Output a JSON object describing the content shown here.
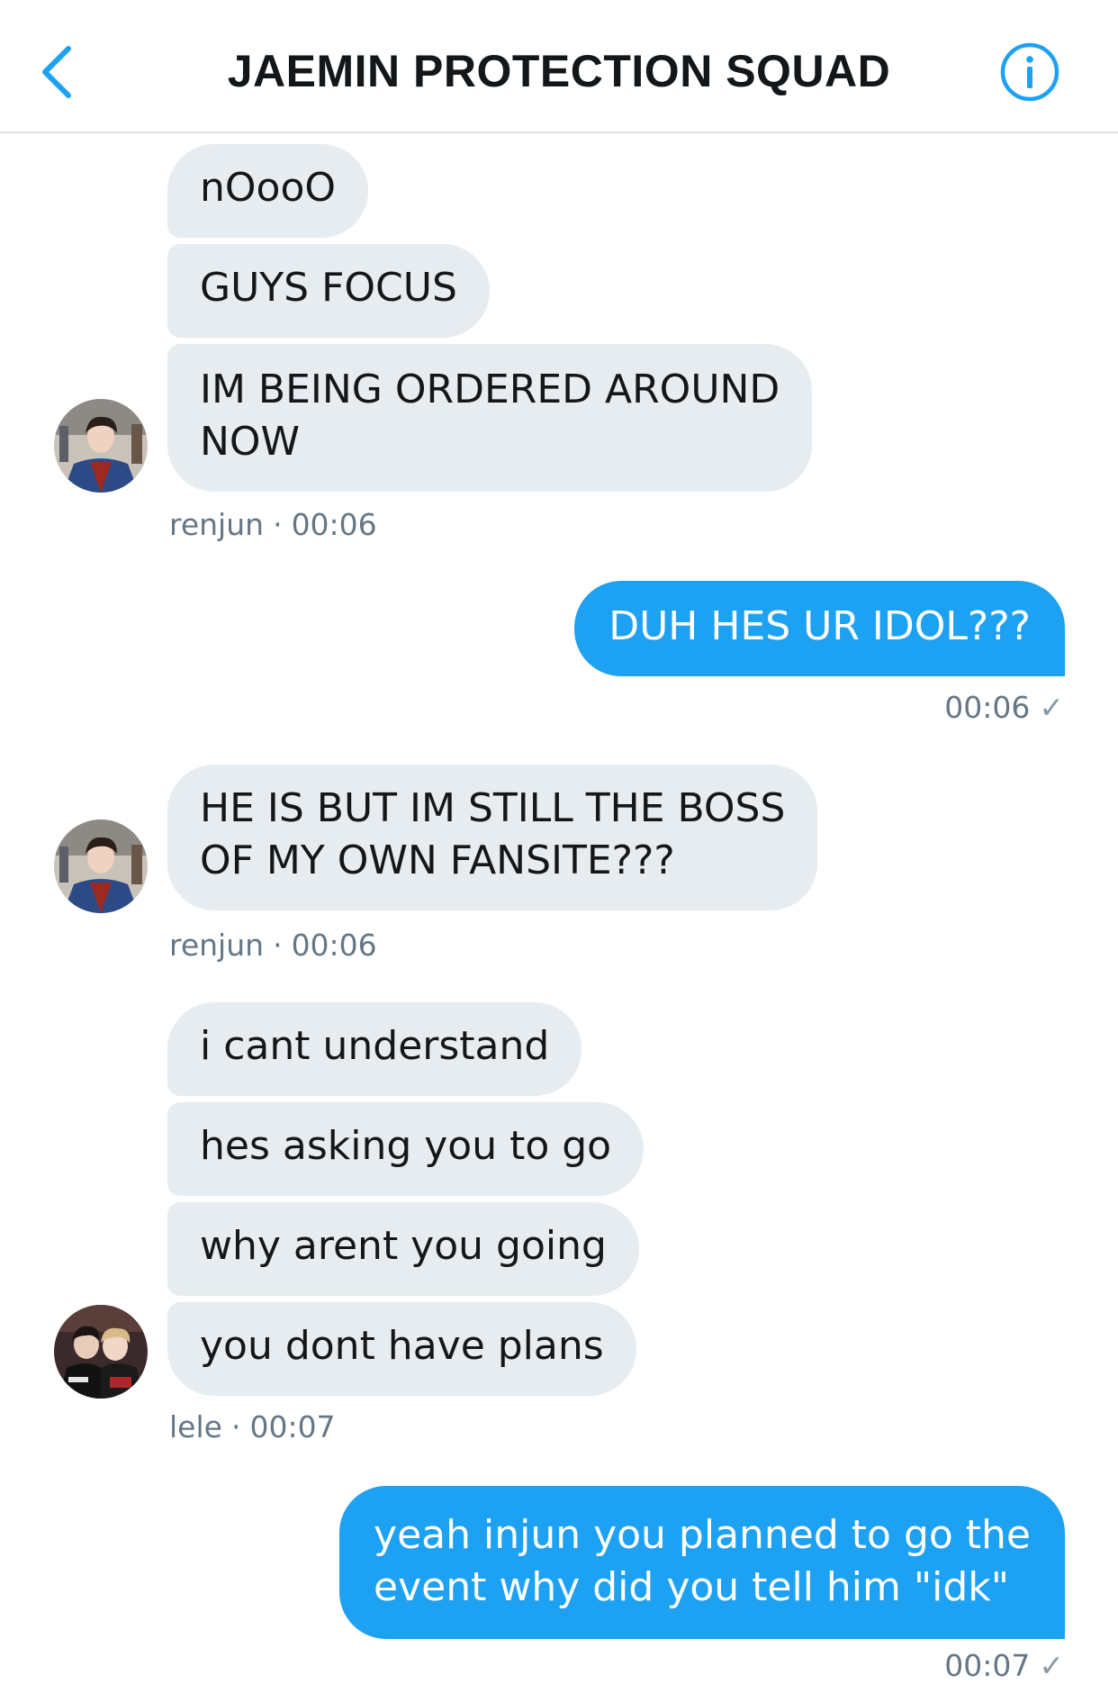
{
  "header": {
    "title": "JAEMIN PROTECTION SQUAD",
    "back_icon": "chevron-left-icon",
    "info_icon": "info-icon",
    "accent_color": "#1da1f2"
  },
  "messages": [
    {
      "sender": "renjun",
      "time": "00:06",
      "bubbles": [
        "nOooO",
        "GUYS FOCUS",
        "IM BEING ORDERED AROUND",
        "NOW"
      ]
    },
    {
      "sender": "me",
      "time": "00:06",
      "bubbles": [
        "DUH HES UR IDOL???"
      ]
    },
    {
      "sender": "renjun",
      "time": "00:06",
      "bubbles": [
        "HE IS BUT IM STILL THE BOSS",
        "OF MY OWN FANSITE???"
      ]
    },
    {
      "sender": "lele",
      "time": "00:07",
      "bubbles": [
        "i cant understand",
        "hes asking you to go",
        "why arent you going",
        "you dont have plans"
      ]
    },
    {
      "sender": "me",
      "time": "00:07",
      "bubbles": [
        "yeah injun you planned to go the",
        "event why did you tell him \"idk\""
      ]
    }
  ],
  "meta_separator": "·",
  "sent_check": "✓",
  "colors": {
    "incoming_bubble": "#e6ecf0",
    "outgoing_bubble": "#1da1f2",
    "meta_text": "#657786"
  }
}
